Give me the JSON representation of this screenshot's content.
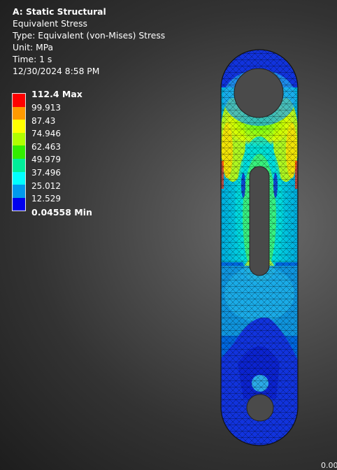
{
  "header": {
    "title": "A: Static Structural",
    "result_name": "Equivalent Stress",
    "type_line": "Type: Equivalent (von-Mises) Stress",
    "unit_line": "Unit: MPa",
    "time_line": "Time: 1 s",
    "timestamp": "12/30/2024 8:58 PM"
  },
  "legend": {
    "unit": "MPa",
    "max_label": "112.4 Max",
    "min_label": "0.04558 Min",
    "levels": [
      "99.913",
      "87.43",
      "74.946",
      "62.463",
      "49.979",
      "37.496",
      "25.012",
      "12.529"
    ],
    "band_colors": [
      "#ff0000",
      "#ff9900",
      "#ffff00",
      "#b0ff00",
      "#33ee00",
      "#00ee99",
      "#00ffff",
      "#0099ee",
      "#0000ee"
    ]
  },
  "model": {
    "description_icon": "fea-link-part-icon"
  },
  "scale": {
    "corner_value": "0.00"
  }
}
